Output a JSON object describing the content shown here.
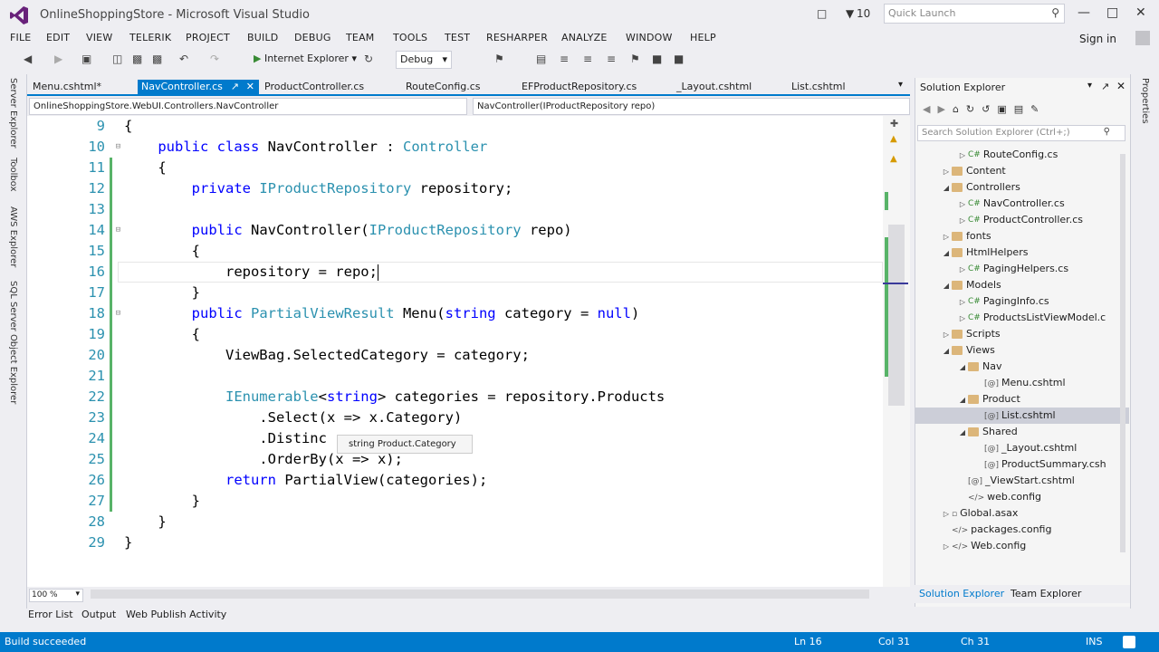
{
  "window": {
    "title": "OnlineShoppingStore - Microsoft Visual Studio",
    "notif_count": "10",
    "quick_launch": "Quick Launch",
    "sign_in": "Sign in"
  },
  "menu": [
    "FILE",
    "EDIT",
    "VIEW",
    "TELERIK",
    "PROJECT",
    "BUILD",
    "DEBUG",
    "TEAM",
    "TOOLS",
    "TEST",
    "RESHARPER",
    "ANALYZE",
    "WINDOW",
    "HELP"
  ],
  "toolbar": {
    "run_target": "Internet Explorer",
    "config": "Debug"
  },
  "left_rail": [
    "Server Explorer",
    "Toolbox",
    "AWS Explorer",
    "SQL Server Object Explorer"
  ],
  "tabs": [
    "Menu.cshtml*",
    "NavController.cs",
    "ProductController.cs",
    "RouteConfig.cs",
    "EFProductRepository.cs",
    "_Layout.cshtml",
    "List.cshtml"
  ],
  "nav": {
    "left": "OnlineShoppingStore.WebUI.Controllers.NavController",
    "right": "NavController(IProductRepository repo)"
  },
  "code_lines": [
    {
      "n": "9",
      "t": "{"
    },
    {
      "n": "10",
      "t": "    public class NavController : Controller"
    },
    {
      "n": "11",
      "t": "    {"
    },
    {
      "n": "12",
      "t": "        private IProductRepository repository;"
    },
    {
      "n": "13",
      "t": ""
    },
    {
      "n": "14",
      "t": "        public NavController(IProductRepository repo)"
    },
    {
      "n": "15",
      "t": "        {"
    },
    {
      "n": "16",
      "t": "            repository = repo;"
    },
    {
      "n": "17",
      "t": "        }"
    },
    {
      "n": "18",
      "t": "        public PartialViewResult Menu(string category = null)"
    },
    {
      "n": "19",
      "t": "        {"
    },
    {
      "n": "20",
      "t": "            ViewBag.SelectedCategory = category;"
    },
    {
      "n": "21",
      "t": ""
    },
    {
      "n": "22",
      "t": "            IEnumerable<string> categories = repository.Products"
    },
    {
      "n": "23",
      "t": "                .Select(x => x.Category)"
    },
    {
      "n": "24",
      "t": "                .Distinc"
    },
    {
      "n": "25",
      "t": "                .OrderBy(x => x);"
    },
    {
      "n": "26",
      "t": "            return PartialView(categories);"
    },
    {
      "n": "27",
      "t": "        }"
    },
    {
      "n": "28",
      "t": "    }"
    },
    {
      "n": "29",
      "t": "}"
    }
  ],
  "tooltip": "string Product.Category",
  "zoom": "100 %",
  "bottom_tabs": [
    "Error List",
    "Output",
    "Web Publish Activity"
  ],
  "status": {
    "msg": "Build succeeded",
    "ln": "Ln 16",
    "col": "Col 31",
    "ch": "Ch 31",
    "ins": "INS"
  },
  "solution_explorer": {
    "title": "Solution Explorer",
    "search": "Search Solution Explorer (Ctrl+;)",
    "items": [
      {
        "label": "RouteConfig.cs",
        "kind": "cs"
      },
      {
        "label": "Content",
        "kind": "folder"
      },
      {
        "label": "Controllers",
        "kind": "folder"
      },
      {
        "label": "NavController.cs",
        "kind": "cs"
      },
      {
        "label": "ProductController.cs",
        "kind": "cs"
      },
      {
        "label": "fonts",
        "kind": "folder"
      },
      {
        "label": "HtmlHelpers",
        "kind": "folder"
      },
      {
        "label": "PagingHelpers.cs",
        "kind": "cs"
      },
      {
        "label": "Models",
        "kind": "folder"
      },
      {
        "label": "PagingInfo.cs",
        "kind": "cs"
      },
      {
        "label": "ProductsListViewModel.c",
        "kind": "cs"
      },
      {
        "label": "Scripts",
        "kind": "folder"
      },
      {
        "label": "Views",
        "kind": "folder"
      },
      {
        "label": "Nav",
        "kind": "folder"
      },
      {
        "label": "Menu.cshtml",
        "kind": "cshtml"
      },
      {
        "label": "Product",
        "kind": "folder"
      },
      {
        "label": "List.cshtml",
        "kind": "cshtml"
      },
      {
        "label": "Shared",
        "kind": "folder"
      },
      {
        "label": "_Layout.cshtml",
        "kind": "cshtml"
      },
      {
        "label": "ProductSummary.csh",
        "kind": "cshtml"
      },
      {
        "label": "_ViewStart.cshtml",
        "kind": "cshtml"
      },
      {
        "label": "web.config",
        "kind": "config"
      },
      {
        "label": "Global.asax",
        "kind": "config"
      },
      {
        "label": "packages.config",
        "kind": "config"
      },
      {
        "label": "Web.config",
        "kind": "config"
      }
    ],
    "tabs": [
      "Solution Explorer",
      "Team Explorer"
    ]
  },
  "right_rail": "Properties",
  "colors": {
    "accent": "#007acc",
    "keyword": "#0000ff",
    "type": "#2b91af",
    "change": "#58b368"
  }
}
